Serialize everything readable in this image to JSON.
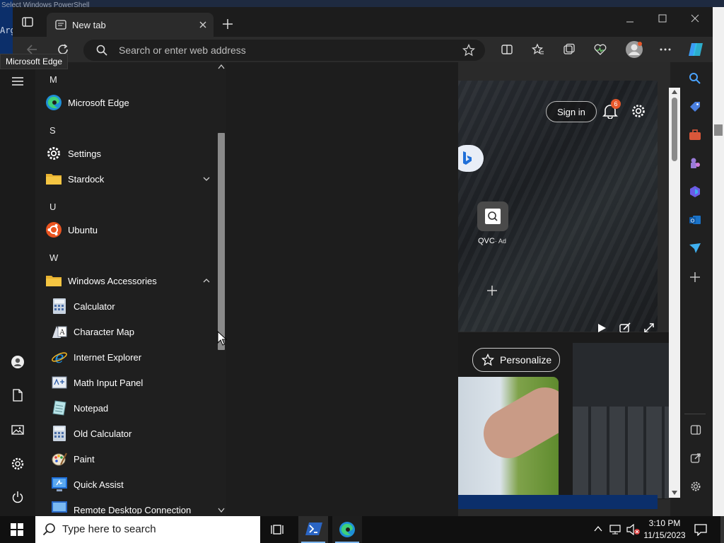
{
  "background_window": {
    "title": "Select Windows PowerShell",
    "console_text": "Arg"
  },
  "edge": {
    "tab_title": "New tab",
    "address_placeholder": "Search or enter web address",
    "tooltip": "Microsoft Edge",
    "signin_label": "Sign in",
    "notification_count": "6",
    "qvc_label": "QVC",
    "qvc_ad": "· Ad",
    "personalize_label": "Personalize"
  },
  "start_menu": {
    "groups": [
      {
        "letter": "M",
        "apps": [
          {
            "label": "Microsoft Edge",
            "icon": "edge-icon"
          }
        ]
      },
      {
        "letter": "S",
        "apps": [
          {
            "label": "Settings",
            "icon": "gear-icon"
          },
          {
            "label": "Stardock",
            "icon": "folder-icon",
            "expand": "down"
          }
        ]
      },
      {
        "letter": "U",
        "apps": [
          {
            "label": "Ubuntu",
            "icon": "ubuntu-icon"
          }
        ]
      },
      {
        "letter": "W",
        "apps": [
          {
            "label": "Windows Accessories",
            "icon": "folder-icon",
            "expand": "up"
          }
        ]
      }
    ],
    "accessories": [
      {
        "label": "Calculator",
        "icon": "calculator-icon"
      },
      {
        "label": "Character Map",
        "icon": "character-map-icon"
      },
      {
        "label": "Internet Explorer",
        "icon": "internet-explorer-icon"
      },
      {
        "label": "Math Input Panel",
        "icon": "math-input-icon"
      },
      {
        "label": "Notepad",
        "icon": "notepad-icon"
      },
      {
        "label": "Old Calculator",
        "icon": "calculator-icon"
      },
      {
        "label": "Paint",
        "icon": "paint-icon"
      },
      {
        "label": "Quick Assist",
        "icon": "quick-assist-icon"
      },
      {
        "label": "Remote Desktop Connection",
        "icon": "remote-desktop-icon"
      }
    ]
  },
  "taskbar": {
    "search_placeholder": "Type here to search",
    "time": "3:10 PM",
    "date": "11/15/2023"
  },
  "colors": {
    "accent": "#0078d4",
    "edge_bg": "#202020",
    "start_bg": "#1f1f1f",
    "badge": "#e8582b"
  }
}
